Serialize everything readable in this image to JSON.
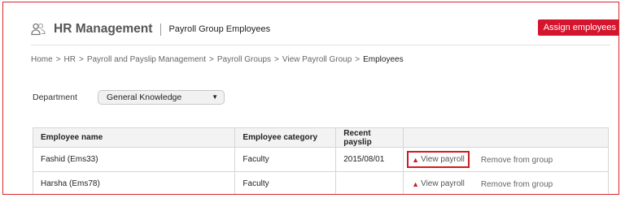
{
  "header": {
    "icon": "users-icon",
    "title": "HR Management",
    "subtitle": "Payroll Group Employees",
    "assign_button": "Assign employees"
  },
  "colors": {
    "accent": "#d5152d",
    "highlight_border": "#d01b23"
  },
  "breadcrumb": [
    "Home",
    "HR",
    "Payroll and Payslip Management",
    "Payroll Groups",
    "View Payroll Group",
    "Employees"
  ],
  "breadcrumb_separator": ">",
  "filter": {
    "label": "Department",
    "selected": "General Knowledge"
  },
  "table": {
    "columns": [
      "Employee name",
      "Employee category",
      "Recent payslip",
      ""
    ],
    "rows": [
      {
        "name": "Fashid (Ems33)",
        "category": "Faculty",
        "payslip": "2015/08/01",
        "view": "View payroll",
        "remove": "Remove from group"
      },
      {
        "name": "Harsha (Ems78)",
        "category": "Faculty",
        "payslip": "",
        "view": "View payroll",
        "remove": "Remove from group"
      }
    ]
  }
}
